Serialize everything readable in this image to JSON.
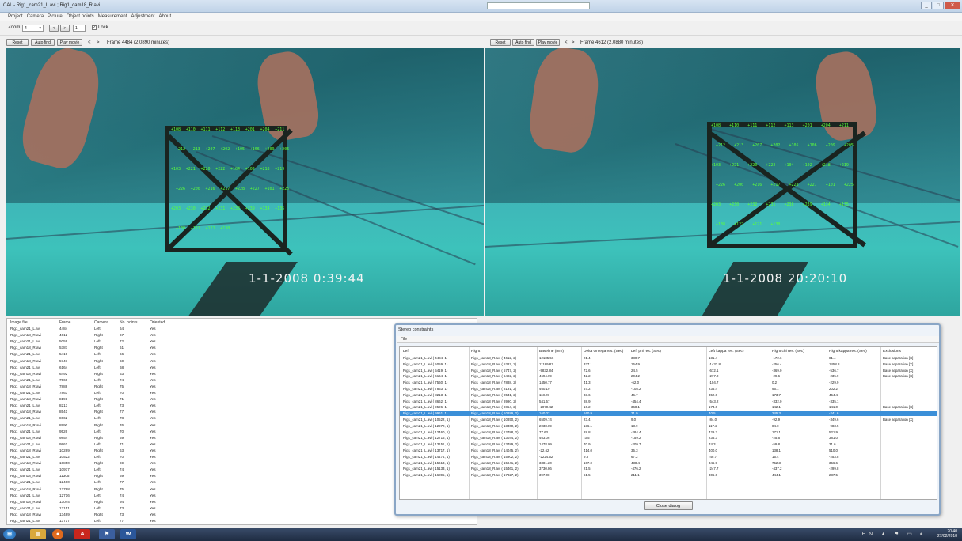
{
  "window": {
    "title": "CAL - Rig1_cam21_L.avi ; Rig1_cam18_R.avi",
    "search_placeholder": "",
    "buttons": [
      "_",
      "□",
      "✕"
    ]
  },
  "menu": [
    "Project",
    "Camera",
    "Picture",
    "Object points",
    "Measurement",
    "Adjustment",
    "About"
  ],
  "zoom": {
    "label": "Zoom",
    "value": "4",
    "stepper_minus": "<",
    "stepper_plus": ">",
    "stepper_value": "1",
    "lock_label": "Lock",
    "lock_checked": true
  },
  "left_view": {
    "buttons": [
      "Reset",
      "Auto find",
      "Play movie"
    ],
    "nav": [
      "<",
      ">"
    ],
    "frame_text": "Frame 4484 (2.0890 minutes)",
    "timestamp": "1-1-2008  0:39:44",
    "points": [
      "+108",
      "+110",
      "+111",
      "+112",
      "+113",
      "+201",
      "+204",
      "+211",
      "+212",
      "+213",
      "+207",
      "+202",
      "+105",
      "+106",
      "+209",
      "+205",
      "+103",
      "+221",
      "+220",
      "+222",
      "+104",
      "+102",
      "+218",
      "+219",
      "+226",
      "+200",
      "+216",
      "+217",
      "+228",
      "+227",
      "+101",
      "+225",
      "+203",
      "+230",
      "+232",
      "+231",
      "+238",
      "+239",
      "+134",
      "+135",
      "+138",
      "+122",
      "+121",
      "+130"
    ]
  },
  "right_view": {
    "buttons": [
      "Reset",
      "Auto find",
      "Play movie"
    ],
    "nav": [
      "<",
      ">"
    ],
    "frame_text": "Frame 4612 (2.0880 minutes)",
    "timestamp": "1-1-2008  20:20:10",
    "points": [
      "+108",
      "+110",
      "+111",
      "+112",
      "+113",
      "+201",
      "+204",
      "+211",
      "+212",
      "+213",
      "+207",
      "+202",
      "+105",
      "+106",
      "+209",
      "+205",
      "+103",
      "+221",
      "+220",
      "+222",
      "+104",
      "+102",
      "+218",
      "+219",
      "+226",
      "+200",
      "+216",
      "+217",
      "+228",
      "+227",
      "+101",
      "+225",
      "+203",
      "+230",
      "+232",
      "+231",
      "+238",
      "+239",
      "+134",
      "+135",
      "+138",
      "+122",
      "+121",
      "+130"
    ]
  },
  "file_list": {
    "headers": [
      "Image file",
      "Frame",
      "Camera",
      "No. points",
      "Oriented"
    ],
    "rows": [
      [
        "Rig1_cam21_L.avi",
        "4484",
        "Left",
        "64",
        "Yes"
      ],
      [
        "Rig1_cam18_R.avi",
        "4612",
        "Right",
        "67",
        "Yes"
      ],
      [
        "Rig1_cam21_L.avi",
        "5059",
        "Left",
        "72",
        "Yes"
      ],
      [
        "Rig1_cam18_R.avi",
        "5387",
        "Right",
        "61",
        "Yes"
      ],
      [
        "Rig1_cam21_L.avi",
        "5419",
        "Left",
        "66",
        "Yes"
      ],
      [
        "Rig1_cam18_R.avi",
        "5747",
        "Right",
        "60",
        "Yes"
      ],
      [
        "Rig1_cam21_L.avi",
        "6164",
        "Left",
        "68",
        "Yes"
      ],
      [
        "Rig1_cam18_R.avi",
        "6492",
        "Right",
        "63",
        "Yes"
      ],
      [
        "Rig1_cam21_L.avi",
        "7560",
        "Left",
        "74",
        "Yes"
      ],
      [
        "Rig1_cam18_R.avi",
        "7888",
        "Right",
        "75",
        "Yes"
      ],
      [
        "Rig1_cam21_L.avi",
        "7863",
        "Left",
        "70",
        "Yes"
      ],
      [
        "Rig1_cam18_R.avi",
        "8191",
        "Right",
        "71",
        "Yes"
      ],
      [
        "Rig1_cam21_L.avi",
        "8213",
        "Left",
        "73",
        "Yes"
      ],
      [
        "Rig1_cam18_R.avi",
        "8541",
        "Right",
        "77",
        "Yes"
      ],
      [
        "Rig1_cam21_L.avi",
        "8662",
        "Left",
        "78",
        "Yes"
      ],
      [
        "Rig1_cam18_R.avi",
        "8990",
        "Right",
        "76",
        "Yes"
      ],
      [
        "Rig1_cam21_L.avi",
        "9526",
        "Left",
        "70",
        "Yes"
      ],
      [
        "Rig1_cam18_R.avi",
        "9854",
        "Right",
        "69",
        "Yes"
      ],
      [
        "Rig1_cam21_L.avi",
        "9961",
        "Left",
        "71",
        "Yes"
      ],
      [
        "Rig1_cam18_R.avi",
        "10289",
        "Right",
        "63",
        "Yes"
      ],
      [
        "Rig1_cam21_L.avi",
        "10522",
        "Left",
        "70",
        "Yes"
      ],
      [
        "Rig1_cam18_R.avi",
        "10850",
        "Right",
        "69",
        "Yes"
      ],
      [
        "Rig1_cam21_L.avi",
        "10977",
        "Left",
        "74",
        "Yes"
      ],
      [
        "Rig1_cam18_R.avi",
        "11305",
        "Right",
        "69",
        "Yes"
      ],
      [
        "Rig1_cam21_L.avi",
        "12460",
        "Left",
        "77",
        "Yes"
      ],
      [
        "Rig1_cam18_R.avi",
        "12788",
        "Right",
        "75",
        "Yes"
      ],
      [
        "Rig1_cam21_L.avi",
        "12716",
        "Left",
        "74",
        "Yes"
      ],
      [
        "Rig1_cam18_R.avi",
        "13044",
        "Right",
        "94",
        "Yes"
      ],
      [
        "Rig1_cam21_L.avi",
        "13151",
        "Left",
        "73",
        "Yes"
      ],
      [
        "Rig1_cam18_R.avi",
        "13489",
        "Right",
        "73",
        "Yes"
      ],
      [
        "Rig1_cam21_L.avi",
        "13717",
        "Left",
        "77",
        "Yes"
      ]
    ]
  },
  "dialog": {
    "title": "Stereo constraints",
    "menu_file": "File",
    "headers": [
      "Left",
      "Right",
      "Baseline (mm)",
      "Delta Omega res. (Sec)",
      "Left phi res. (Sec)",
      "Left kappa res. (Sec)",
      "Right chi res. (Sec)",
      "Right kappa res. (Sec)",
      "Exclusions"
    ],
    "rows": [
      [
        "Rig1_cam21_L.avi ( 4484, 1)",
        "Rig1_cam18_R.avi ( 4612, 2)",
        "12185.56",
        "21.4",
        "380.7",
        "131.4",
        "-172.6",
        "81.4",
        "Base separation [X]"
      ],
      [
        "Rig1_cam21_L.avi ( 5059, 1)",
        "Rig1_cam18_R.avi ( 5387, 2)",
        "11189.87",
        "337.1",
        "164.9",
        "-1432.8",
        "-256.4",
        "1458.8",
        "Base separation [X]"
      ],
      [
        "Rig1_cam21_L.avi ( 5419, 1)",
        "Rig1_cam18_R.avi ( 5747, 2)",
        "-9832.84",
        "72.6",
        "24.5",
        "-672.1",
        "-369.0",
        "-536.7",
        "Base separation [X]"
      ],
      [
        "Rig1_cam21_L.avi ( 6164, 1)",
        "Rig1_cam18_R.avi ( 6492, 2)",
        "4694.09",
        "42.2",
        "204.2",
        "-277.0",
        "-29.6",
        "-235.9",
        "Base separation [X]"
      ],
      [
        "Rig1_cam21_L.avi ( 7560, 1)",
        "Rig1_cam18_R.avi ( 7888, 2)",
        "1450.77",
        "41.3",
        "-62.0",
        "-104.7",
        "0.2",
        "-229.9",
        ""
      ],
      [
        "Rig1_cam21_L.avi ( 7863, 1)",
        "Rig1_cam18_R.avi ( 8191, 2)",
        "460.19",
        "57.2",
        "-108.2",
        "236.4",
        "96.1",
        "202.2",
        ""
      ],
      [
        "Rig1_cam21_L.avi ( 8213, 1)",
        "Rig1_cam18_R.avi ( 8541, 2)",
        "118.07",
        "33.6",
        "46.7",
        "352.6",
        "173.7",
        "454.4",
        ""
      ],
      [
        "Rig1_cam21_L.avi ( 8662, 1)",
        "Rig1_cam18_R.avi ( 8990, 2)",
        "541.57",
        "88.9",
        "-454.4",
        "-543.2",
        "-332.0",
        "-335.1",
        ""
      ],
      [
        "Rig1_cam21_L.avi ( 9526, 1)",
        "Rig1_cam18_R.avi ( 9854, 2)",
        "-2070.42",
        "16.2",
        "368.1",
        "174.6",
        "142.1",
        "141.0",
        "Base separation [X]"
      ],
      [
        "Rig1_cam21_L.avi ( 9961, 1)",
        "Rig1_cam18_R.avi ( 10289, 2)",
        "160.02",
        "160.9",
        "31.9",
        "40.5",
        "245.3",
        "-241.6",
        ""
      ],
      [
        "Rig1_cam21_L.avi ( 10522, 1)",
        "Rig1_cam18_R.avi ( 10850, 2)",
        "6509.74",
        "23.4",
        "9.0",
        "-84.0",
        "-92.9",
        "-349.6",
        "Base separation [X]"
      ],
      [
        "Rig1_cam21_L.avi ( 12972, 1)",
        "Rig1_cam18_R.avi ( 13300, 2)",
        "2038.89",
        "136.1",
        "13.9",
        "117.2",
        "84.0",
        "-983.5",
        ""
      ],
      [
        "Rig1_cam21_L.avi ( 12460, 1)",
        "Rig1_cam18_R.avi ( 12788, 2)",
        "77.63",
        "28.8",
        "-284.4",
        "429.3",
        "171.1",
        "521.9",
        ""
      ],
      [
        "Rig1_cam21_L.avi ( 12716, 1)",
        "Rig1_cam18_R.avi ( 13044, 2)",
        "463.06",
        "-3.5",
        "-159.2",
        "235.3",
        "-25.6",
        "381.0",
        ""
      ],
      [
        "Rig1_cam21_L.avi ( 13151, 1)",
        "Rig1_cam18_R.avi ( 13489, 2)",
        "1478.09",
        "70.9",
        "-209.7",
        "74.3",
        "-59.8",
        "31.6",
        ""
      ],
      [
        "Rig1_cam21_L.avi ( 13717, 1)",
        "Rig1_cam18_R.avi ( 14045, 2)",
        "-22.62",
        "414.0",
        "35.3",
        "400.0",
        "138.1",
        "510.0",
        ""
      ],
      [
        "Rig1_cam21_L.avi ( 14474, 1)",
        "Rig1_cam18_R.avi ( 15902, 2)",
        "-2224.52",
        "9.3",
        "67.2",
        "-49.7",
        "15.4",
        "-253.8",
        ""
      ],
      [
        "Rig1_cam21_L.avi ( 15613, 1)",
        "Rig1_cam18_R.avi ( 15941, 2)",
        "3381.20",
        "107.0",
        "438.4",
        "346.9",
        "752.3",
        "356.6",
        ""
      ],
      [
        "Rig1_cam21_L.avi ( 15133, 1)",
        "Rig1_cam18_R.avi ( 15461, 2)",
        "3730.86",
        "21.5",
        "-476.2",
        "-247.7",
        "-437.2",
        "-299.8",
        ""
      ],
      [
        "Rig1_cam21_L.avi ( 16895, 1)",
        "Rig1_cam18_R.avi ( 17827, 2)",
        "397.08",
        "61.5",
        "211.1",
        "306.6",
        "444.1",
        "287.5",
        ""
      ]
    ],
    "selected_row": 9,
    "close_label": "Close dialog"
  },
  "taskbar": {
    "icons": [
      "start-orb",
      "explorer",
      "firefox",
      "acrobat",
      "app-flag",
      "word"
    ],
    "tray": "EN  ▲  ⚑  ▭  ◐",
    "time": "20:40",
    "date": "27/02/2018"
  }
}
